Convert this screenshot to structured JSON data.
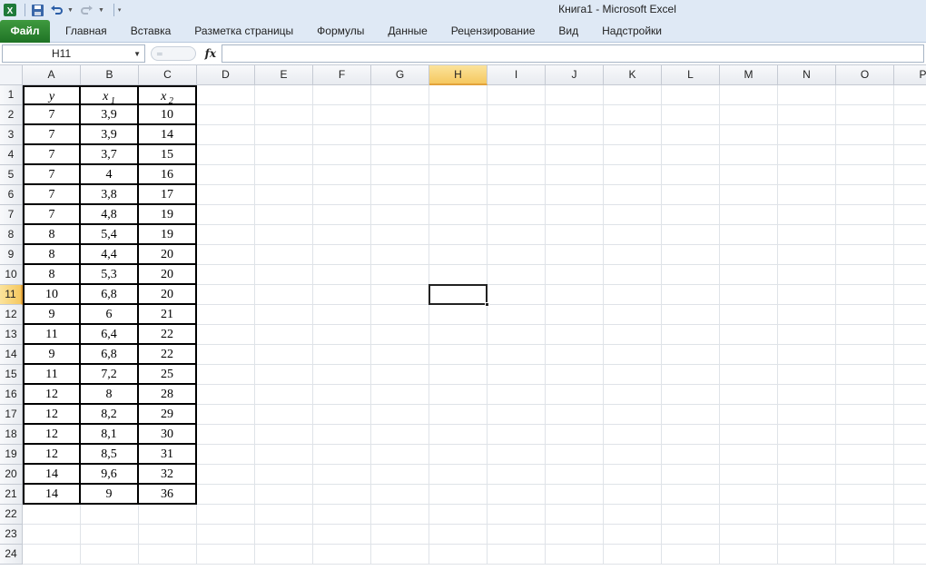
{
  "window": {
    "title": "Книга1  -  Microsoft Excel",
    "icons": [
      "excel-icon",
      "save-icon",
      "undo-icon",
      "redo-icon",
      "customize-qat-icon"
    ]
  },
  "ribbon": {
    "file_tab": "Файл",
    "tabs": [
      "Главная",
      "Вставка",
      "Разметка страницы",
      "Формулы",
      "Данные",
      "Рецензирование",
      "Вид",
      "Надстройки"
    ]
  },
  "formula_bar": {
    "name_box": "H11",
    "fx_label": "fx",
    "formula": ""
  },
  "sheet": {
    "columns": [
      "A",
      "B",
      "C",
      "D",
      "E",
      "F",
      "G",
      "H",
      "I",
      "J",
      "K",
      "L",
      "M",
      "N",
      "O",
      "P"
    ],
    "selected_column": "H",
    "selected_row": "11",
    "rows": [
      "1",
      "2",
      "3",
      "4",
      "5",
      "6",
      "7",
      "8",
      "9",
      "10",
      "11",
      "12",
      "13",
      "14",
      "15",
      "16",
      "17",
      "18",
      "19",
      "20",
      "21",
      "22",
      "23",
      "24"
    ],
    "header": {
      "a": "y",
      "b_base": "x",
      "b_sub": "1",
      "c_base": "x",
      "c_sub": "2"
    },
    "data": [
      [
        "7",
        "3,9",
        "10"
      ],
      [
        "7",
        "3,9",
        "14"
      ],
      [
        "7",
        "3,7",
        "15"
      ],
      [
        "7",
        "4",
        "16"
      ],
      [
        "7",
        "3,8",
        "17"
      ],
      [
        "7",
        "4,8",
        "19"
      ],
      [
        "8",
        "5,4",
        "19"
      ],
      [
        "8",
        "4,4",
        "20"
      ],
      [
        "8",
        "5,3",
        "20"
      ],
      [
        "10",
        "6,8",
        "20"
      ],
      [
        "9",
        "6",
        "21"
      ],
      [
        "11",
        "6,4",
        "22"
      ],
      [
        "9",
        "6,8",
        "22"
      ],
      [
        "11",
        "7,2",
        "25"
      ],
      [
        "12",
        "8",
        "28"
      ],
      [
        "12",
        "8,2",
        "29"
      ],
      [
        "12",
        "8,1",
        "30"
      ],
      [
        "12",
        "8,5",
        "31"
      ],
      [
        "14",
        "9,6",
        "32"
      ],
      [
        "14",
        "9",
        "36"
      ]
    ]
  },
  "colors": {
    "file_tab": "#2e7d32",
    "selected_header": "#f5c85f",
    "ribbon_bg": "#dfe9f5"
  }
}
